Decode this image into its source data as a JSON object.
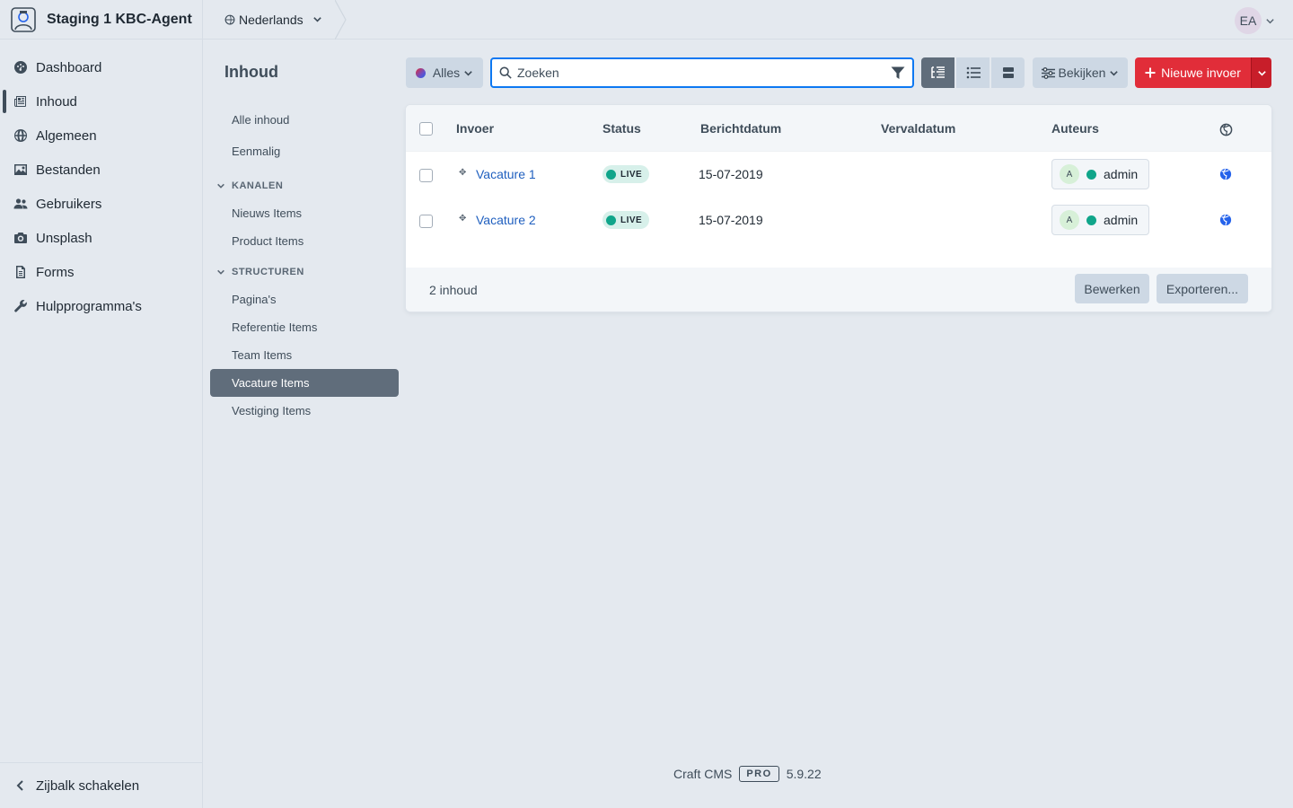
{
  "site": {
    "name": "Staging 1 KBC-Agent",
    "language": "Nederlands"
  },
  "nav": {
    "items": [
      {
        "label": "Dashboard",
        "icon": "gauge-icon"
      },
      {
        "label": "Inhoud",
        "icon": "newspaper-icon",
        "selected": true
      },
      {
        "label": "Algemeen",
        "icon": "globe-icon"
      },
      {
        "label": "Bestanden",
        "icon": "image-icon"
      },
      {
        "label": "Gebruikers",
        "icon": "users-icon"
      },
      {
        "label": "Unsplash",
        "icon": "camera-icon"
      },
      {
        "label": "Forms",
        "icon": "document-icon"
      },
      {
        "label": "Hulpprogramma's",
        "icon": "wrench-icon"
      }
    ],
    "toggle_label": "Zijbalk schakelen"
  },
  "account": {
    "initials": "EA"
  },
  "content": {
    "title": "Inhoud",
    "sources": {
      "all": "Alle inhoud",
      "single": "Eenmalig",
      "channels_heading": "KANALEN",
      "channels": [
        "Nieuws Items",
        "Product Items"
      ],
      "structures_heading": "STRUCTUREN",
      "structures": [
        "Pagina's",
        "Referentie Items",
        "Team Items",
        "Vacature Items",
        "Vestiging Items"
      ],
      "selected": "Vacature Items"
    }
  },
  "toolbar": {
    "status_label": "Alles",
    "search_placeholder": "Zoeken",
    "view_label": "Bekijken",
    "new_label": "Nieuwe invoer"
  },
  "table": {
    "columns": [
      "Invoer",
      "Status",
      "Berichtdatum",
      "Vervaldatum",
      "Auteurs"
    ],
    "rows": [
      {
        "title": "Vacature 1",
        "status": "LIVE",
        "post_date": "15-07-2019",
        "expiry": "",
        "author_initial": "A",
        "author": "admin"
      },
      {
        "title": "Vacature 2",
        "status": "LIVE",
        "post_date": "15-07-2019",
        "expiry": "",
        "author_initial": "A",
        "author": "admin"
      }
    ],
    "count_label": "2 inhoud",
    "edit_label": "Bewerken",
    "export_label": "Exporteren..."
  },
  "footer": {
    "product": "Craft CMS",
    "edition": "PRO",
    "version": "5.9.22"
  },
  "colors": {
    "accent": "#e12d39",
    "link": "#1f5fbf",
    "live": "#10a58a",
    "focus": "#0d78f2"
  }
}
